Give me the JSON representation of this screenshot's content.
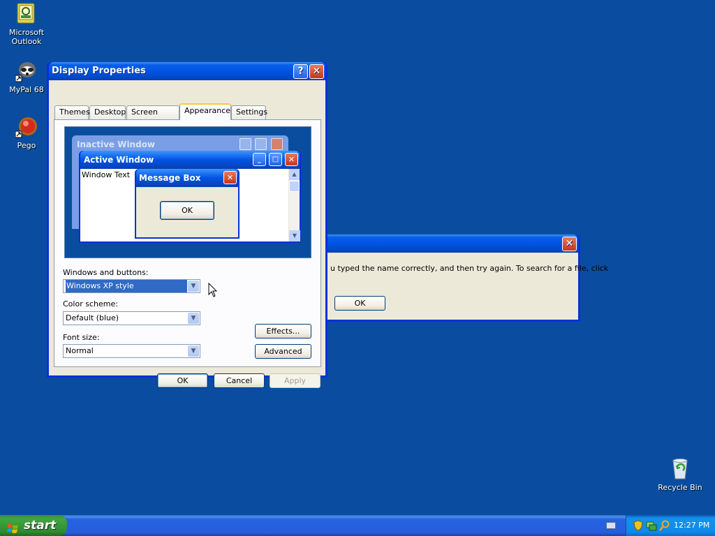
{
  "desktop": {
    "icons": [
      {
        "label_line1": "Microsoft",
        "label_line2": "Outlook"
      },
      {
        "label_line1": "MyPal 68",
        "label_line2": ""
      },
      {
        "label_line1": "Pego",
        "label_line2": ""
      },
      {
        "label_line1": "Recycle Bin",
        "label_line2": ""
      }
    ]
  },
  "error_dialog": {
    "message": "u typed the name correctly, and then try again. To search for a file, click",
    "ok_label": "OK"
  },
  "display_properties": {
    "title": "Display Properties",
    "tabs": [
      "Themes",
      "Desktop",
      "Screen Saver",
      "Appearance",
      "Settings"
    ],
    "active_tab": "Appearance",
    "preview": {
      "inactive_title": "Inactive Window",
      "active_title": "Active Window",
      "window_text": "Window Text",
      "message_title": "Message Box",
      "message_ok": "OK"
    },
    "windows_buttons_label": "Windows and buttons:",
    "windows_buttons_value": "Windows XP style",
    "color_scheme_label": "Color scheme:",
    "color_scheme_value": "Default (blue)",
    "font_size_label": "Font size:",
    "font_size_value": "Normal",
    "effects_label": "Effects...",
    "advanced_label": "Advanced",
    "ok_label": "OK",
    "cancel_label": "Cancel",
    "apply_label": "Apply"
  },
  "taskbar": {
    "start_label": "start",
    "clock": "12:27 PM"
  },
  "colors": {
    "desktop": "#0a4da0",
    "titlebar": "#0054e3",
    "dialog_face": "#ece9d8",
    "start_green": "#3fa63f"
  }
}
